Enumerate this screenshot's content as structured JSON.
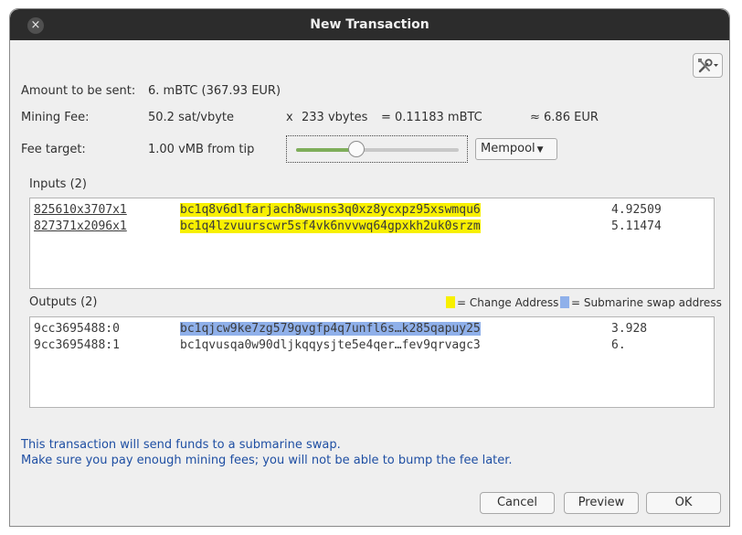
{
  "window": {
    "title": "New Transaction",
    "close_icon": "×"
  },
  "summary": {
    "amount_label": "Amount to be sent:",
    "amount_value": "6. mBTC (367.93 EUR)",
    "fee_label": "Mining Fee:",
    "fee_rate": "50.2 sat/vbyte",
    "fee_times": "x",
    "fee_size": "233 vbytes",
    "fee_equals": "= 0.11183 mBTC",
    "fee_fiat": "≈ 6.86 EUR",
    "target_label": "Fee target:",
    "target_value": "1.00 vMB from tip",
    "fee_slider_fraction": 0.37,
    "fee_method": "Mempool"
  },
  "inputs": {
    "label": "Inputs (2)",
    "rows": [
      {
        "outpoint": "825610x3707x1",
        "address": "bc1q8v6dlfarjach8wusns3q0xz8ycxpz95xswmqu6",
        "amount": "4.92509"
      },
      {
        "outpoint": "827371x2096x1",
        "address": "bc1q4lzvuurscwr5sf4vk6nvvwq64gpxkh2uk0srzm",
        "amount": "5.11474"
      }
    ]
  },
  "outputs": {
    "label": "Outputs (2)",
    "legend": {
      "change": "= Change Address",
      "swap": "= Submarine swap address"
    },
    "rows": [
      {
        "outpoint": "9cc3695488:0",
        "address": "bc1qjcw9ke7zg579gvgfp4q7unfl6s…k285qapuy25",
        "amount": "3.928"
      },
      {
        "outpoint": "9cc3695488:1",
        "address": "bc1qvusqa0w90dljkqqysjte5e4qer…fev9qrvagc3",
        "amount": "6."
      }
    ]
  },
  "warning": {
    "line1": "This transaction will send funds to a submarine swap.",
    "line2": "Make sure you pay enough mining fees; you will not be able to bump the fee later."
  },
  "buttons": {
    "cancel": "Cancel",
    "preview": "Preview",
    "ok": "OK"
  },
  "colors": {
    "change_highlight": "#f8f000",
    "swap_highlight": "#8fb0ea",
    "slider_fill": "#7fae5a",
    "warning_text": "#1f4fa3"
  }
}
